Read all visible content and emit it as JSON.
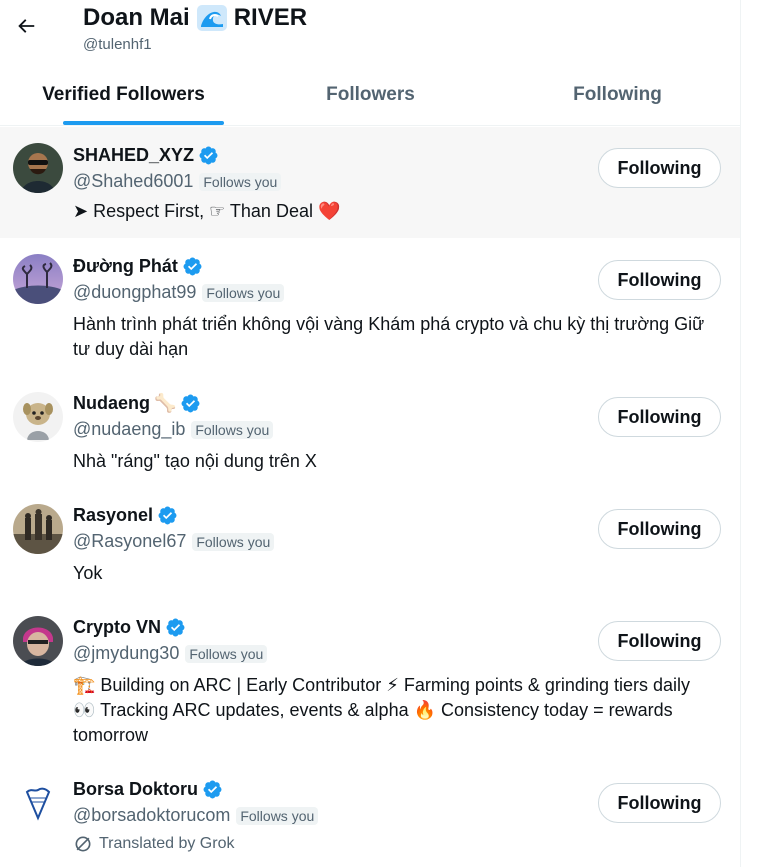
{
  "header": {
    "name": "Doan Mai",
    "name_suffix": "RIVER",
    "handle": "@tulenhf1"
  },
  "tabs": [
    {
      "label": "Verified Followers",
      "active": true
    },
    {
      "label": "Followers",
      "active": false
    },
    {
      "label": "Following",
      "active": false
    }
  ],
  "users": [
    {
      "name": "SHAHED_XYZ",
      "handle": "@Shahed6001",
      "follows_you": "Follows you",
      "bio": "➤ Respect First, ☞ Than Deal ❤️",
      "button": "Following"
    },
    {
      "name": "Đường Phát",
      "handle": "@duongphat99",
      "follows_you": "Follows you",
      "bio": "Hành trình phát triển không vội vàng Khám phá crypto và chu kỳ thị trường Giữ tư duy dài hạn",
      "button": "Following"
    },
    {
      "name": "Nudaeng",
      "name_emoji": "🦴",
      "handle": "@nudaeng_ib",
      "follows_you": "Follows you",
      "bio": "Nhà \"ráng\" tạo nội dung trên X",
      "button": "Following"
    },
    {
      "name": "Rasyonel",
      "handle": "@Rasyonel67",
      "follows_you": "Follows you",
      "bio": "Yok",
      "button": "Following"
    },
    {
      "name": "Crypto VN",
      "handle": "@jmydung30",
      "follows_you": "Follows you",
      "bio": "🏗️ Building on ARC | Early Contributor ⚡ Farming points & grinding tiers daily 👀 Tracking ARC updates, events & alpha 🔥 Consistency today = rewards tomorrow",
      "button": "Following"
    },
    {
      "name": "Borsa Doktoru",
      "handle": "@borsadoktorucom",
      "follows_you": "Follows you",
      "translated": "Translated by Grok",
      "button": "Following"
    }
  ],
  "colors": {
    "accent": "#1d9bf0",
    "secondary_text": "#536471",
    "hover_row": "#f7f7f7"
  }
}
